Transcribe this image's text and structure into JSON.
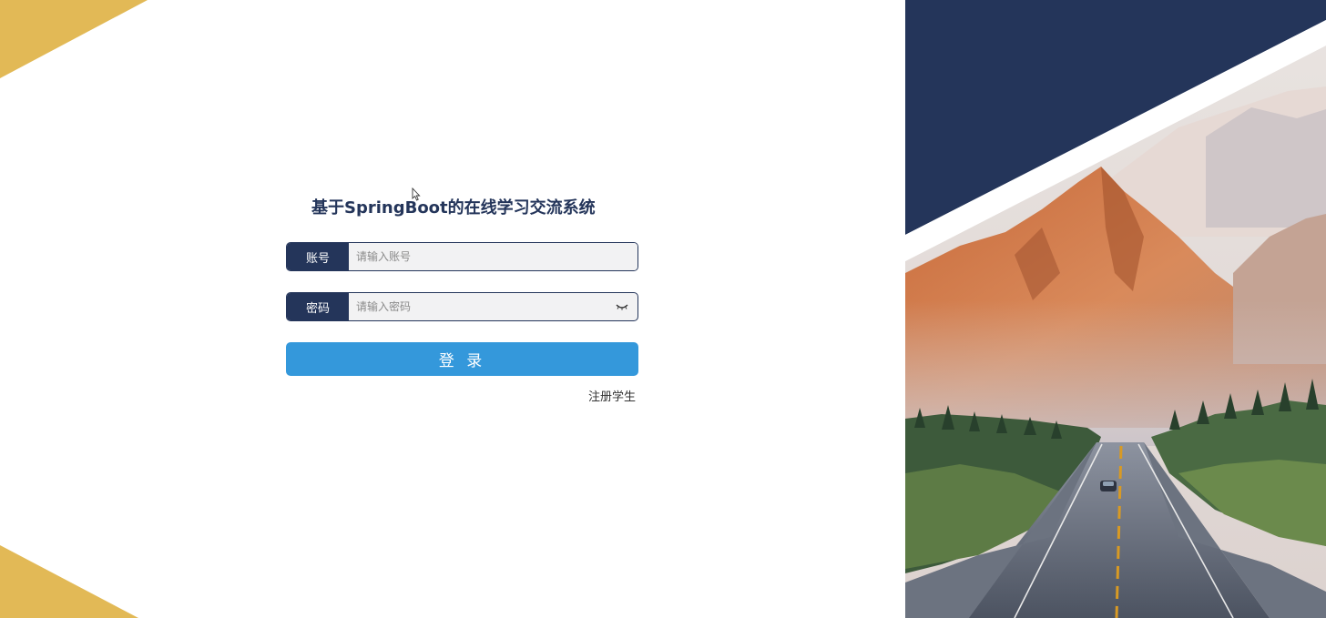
{
  "app": {
    "title": "基于SpringBoot的在线学习交流系统"
  },
  "form": {
    "account": {
      "label": "账号",
      "placeholder": "请输入账号",
      "value": ""
    },
    "password": {
      "label": "密码",
      "placeholder": "请输入密码",
      "value": "",
      "toggle_icon": "eye-closed-icon"
    },
    "login_label": "登 录",
    "register_label": "注册学生"
  },
  "theme": {
    "navy": "#24355a",
    "accent_blue": "#3498db",
    "gold": "#e2b956",
    "input_bg": "#f2f2f3"
  },
  "hero_image": {
    "subject": "mountain-road-landscape"
  }
}
